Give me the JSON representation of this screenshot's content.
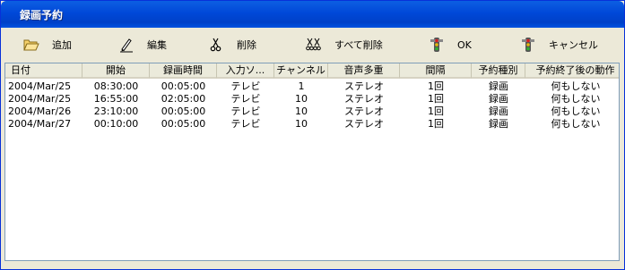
{
  "window": {
    "title": "録画予約"
  },
  "toolbar": {
    "add": {
      "label": "追加",
      "icon": "folder-open-icon"
    },
    "edit": {
      "label": "編集",
      "icon": "pencil-icon"
    },
    "delete": {
      "label": "削除",
      "icon": "scissors-icon"
    },
    "delete_all": {
      "label": "すべて削除",
      "icon": "scissors-double-icon"
    },
    "ok": {
      "label": "OK",
      "icon": "traffic-light-icon"
    },
    "cancel": {
      "label": "キャンセル",
      "icon": "traffic-light-icon"
    }
  },
  "table": {
    "columns": [
      "日付",
      "開始",
      "録画時間",
      "入力ソ...",
      "チャンネル",
      "音声多重",
      "間隔",
      "予約種別",
      "予約終了後の動作"
    ],
    "rows": [
      [
        "2004/Mar/25",
        "08:30:00",
        "00:05:00",
        "テレビ",
        "1",
        "ステレオ",
        "1回",
        "録画",
        "何もしない"
      ],
      [
        "2004/Mar/25",
        "16:55:00",
        "02:05:00",
        "テレビ",
        "10",
        "ステレオ",
        "1回",
        "録画",
        "何もしない"
      ],
      [
        "2004/Mar/26",
        "23:10:00",
        "00:05:00",
        "テレビ",
        "10",
        "ステレオ",
        "1回",
        "録画",
        "何もしない"
      ],
      [
        "2004/Mar/27",
        "00:10:00",
        "00:05:00",
        "テレビ",
        "10",
        "ステレオ",
        "1回",
        "録画",
        "何もしない"
      ]
    ]
  }
}
